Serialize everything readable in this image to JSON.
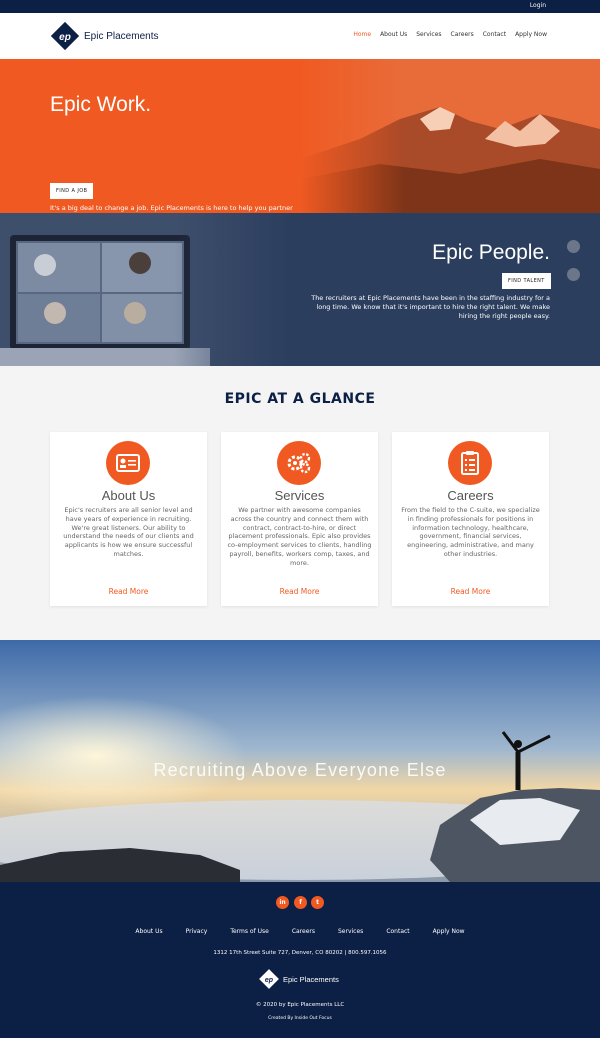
{
  "topbar": {
    "login": "Login"
  },
  "header": {
    "logo_text": "Epic Placements",
    "nav": [
      "Home",
      "About Us",
      "Services",
      "Careers",
      "Contact",
      "Apply Now"
    ],
    "active_nav": "Home"
  },
  "hero_work": {
    "title": "Epic Work.",
    "button": "FIND A JOB",
    "text": "It's a big deal to change a job. Epic Placements is here to help you partner with great companies, doing awesome work."
  },
  "hero_people": {
    "title": "Epic People.",
    "button": "FIND TALENT",
    "text": "The recruiters at Epic Placements have been in the staffing industry for a long time. We know that it's important to hire the right talent. We make hiring the right people easy."
  },
  "glance": {
    "title": "EPIC AT A GLANCE",
    "cards": [
      {
        "icon": "id-card-icon",
        "title": "About Us",
        "text": "Epic's recruiters are all senior level and have years of experience in recruiting. We're great listeners. Our ability to understand the needs of our clients and applicants is how we ensure successful matches.",
        "link": "Read More"
      },
      {
        "icon": "gears-icon",
        "title": "Services",
        "text": "We partner with awesome companies across the country and connect them with contract, contract-to-hire, or direct placement professionals. Epic also provides co-employment services to clients, handling payroll, benefits, workers comp, taxes, and more.",
        "link": "Read More"
      },
      {
        "icon": "clipboard-icon",
        "title": "Careers",
        "text": "From the field to the C-suite, we specialize in finding professionals for positions in information technology, healthcare, government, financial services, engineering, administrative, and many other industries.",
        "link": "Read More"
      }
    ]
  },
  "banner": {
    "text": "Recruiting Above Everyone Else"
  },
  "footer": {
    "social": [
      {
        "icon": "linkedin-icon",
        "glyph": "in"
      },
      {
        "icon": "facebook-icon",
        "glyph": "f"
      },
      {
        "icon": "twitter-icon",
        "glyph": "t"
      }
    ],
    "nav": [
      "About Us",
      "Privacy",
      "Terms of Use",
      "Careers",
      "Services",
      "Contact",
      "Apply Now"
    ],
    "address": "1312 17th Street Suite 727, Denver, CO 80202 | 800.597.1056",
    "logo_text": "Epic Placements",
    "copyright": "© 2020 by Epic Placements LLC",
    "created": "Created By Inside Out Focus"
  },
  "colors": {
    "navy": "#0c1f44",
    "orange": "#f05a22",
    "slate": "#2c3e5e"
  }
}
